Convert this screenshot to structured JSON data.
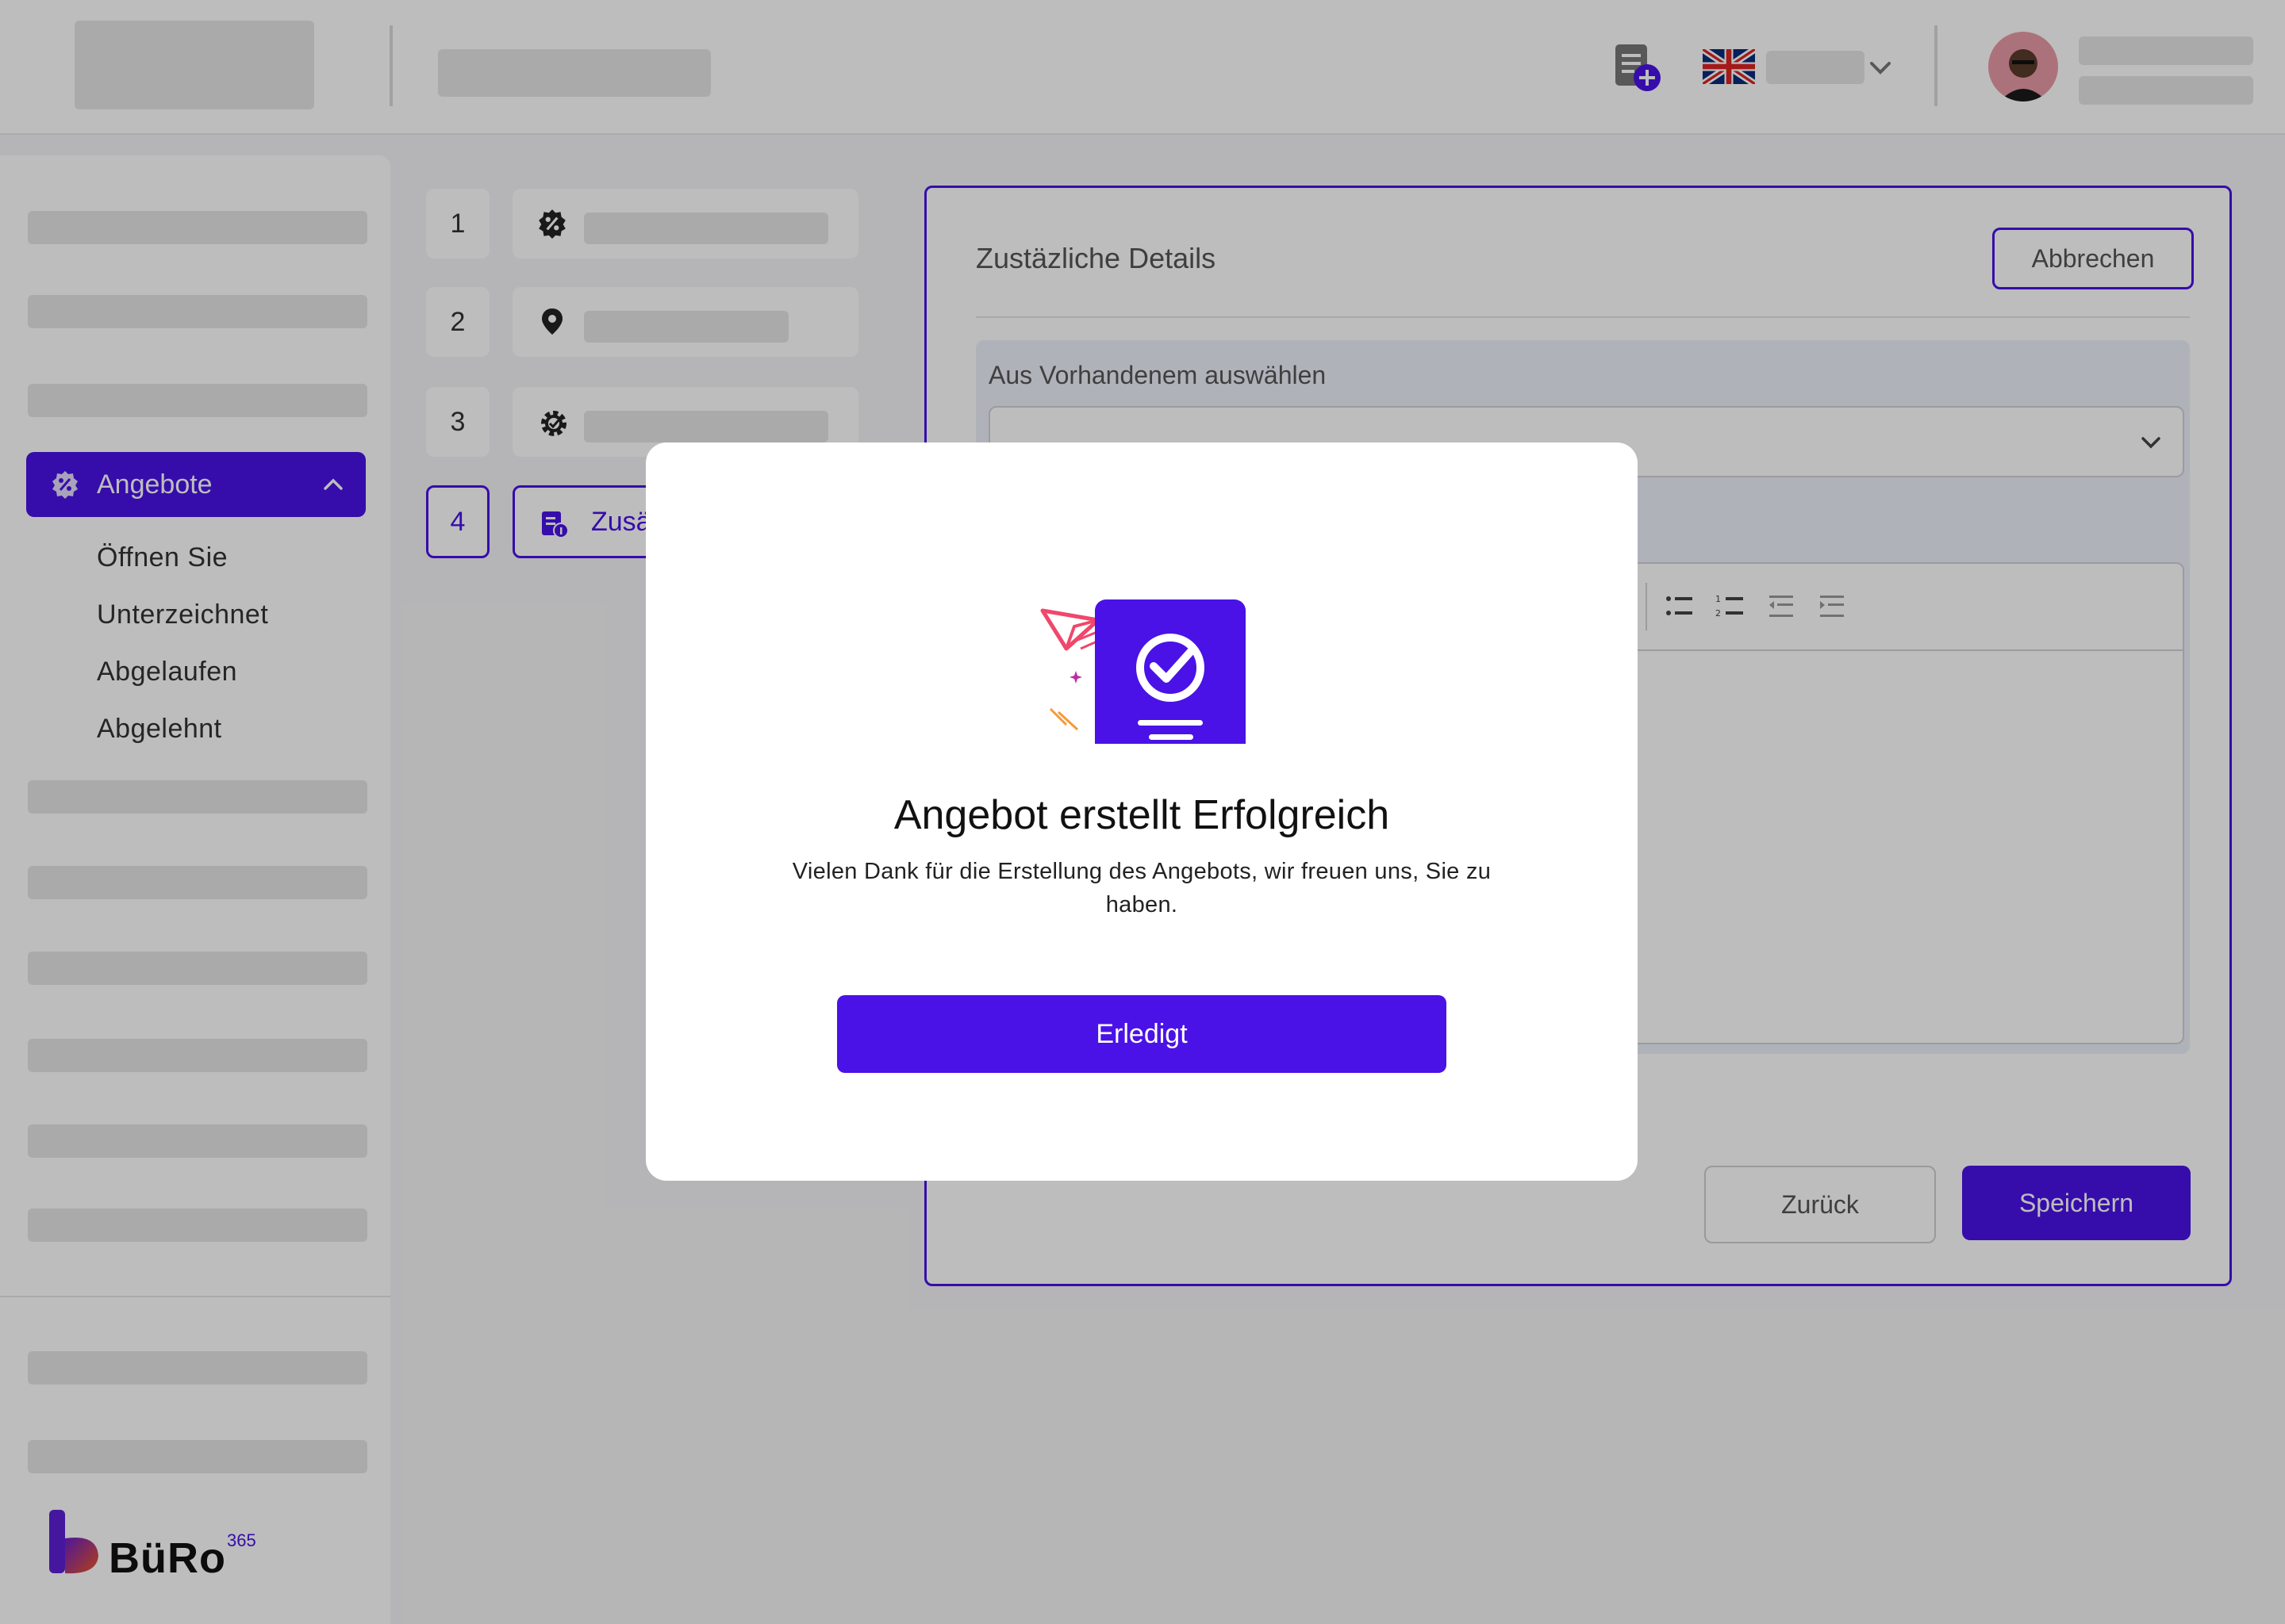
{
  "header": {
    "language_icon": "uk-flag-icon",
    "new_doc_icon": "new-document-icon"
  },
  "sidebar": {
    "active_item": {
      "label": "Angebote",
      "icon": "percent-badge-icon"
    },
    "subitems": [
      {
        "label": "Öffnen Sie"
      },
      {
        "label": "Unterzeichnet"
      },
      {
        "label": "Abgelaufen"
      },
      {
        "label": "Abgelehnt"
      }
    ],
    "logo": {
      "text": "BüRo",
      "sup": "365"
    }
  },
  "steps": [
    {
      "number": "1",
      "icon": "percent-badge-icon"
    },
    {
      "number": "2",
      "icon": "location-pin-icon"
    },
    {
      "number": "3",
      "icon": "gear-icon"
    },
    {
      "number": "4",
      "icon": "details-icon",
      "label": "Zusätzliche Details"
    }
  ],
  "panel": {
    "title": "Zustäzliche Details",
    "cancel_label": "Abbrechen",
    "select_label": "Aus Vorhandenem auswählen",
    "select_value": "",
    "back_label": "Zurück",
    "save_label": "Speichern"
  },
  "modal": {
    "title": "Angebot erstellt Erfolgreich",
    "message": "Vielen Dank für die Erstellung des Angebots, wir freuen uns, Sie zu haben.",
    "button_label": "Erledigt"
  },
  "colors": {
    "accent": "#4a12e6",
    "overlay": "rgba(0,0,0,0.26)",
    "background": "#f5f5f7"
  }
}
